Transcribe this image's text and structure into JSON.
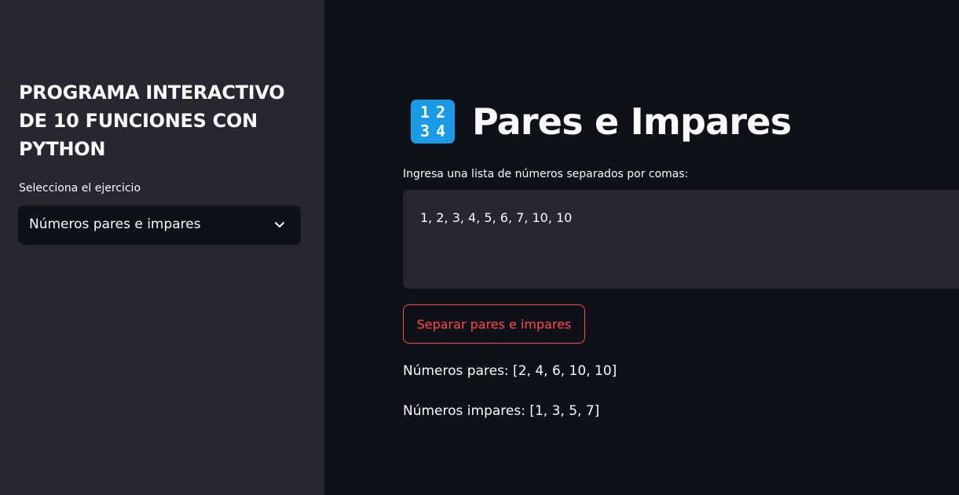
{
  "sidebar": {
    "title": "PROGRAMA INTERACTIVO DE 10 FUNCIONES CON PYTHON",
    "select_label": "Selecciona el ejercicio",
    "select_value": "Números pares e impares"
  },
  "main": {
    "icon_digits": [
      "1",
      "2",
      "3",
      "4"
    ],
    "title": "Pares e Impares",
    "input_label": "Ingresa una lista de números separados por comas:",
    "input_value": "1, 2, 3, 4, 5, 6, 7, 10, 10",
    "button_label": "Separar pares e impares",
    "even_result": "Números pares: [2, 4, 6, 10, 10]",
    "odd_result": "Números impares: [1, 3, 5, 7]"
  },
  "colors": {
    "app_background": "#0e1117",
    "sidebar_background": "#262730",
    "accent": "#ff4b4b",
    "icon_background": "#1b9be6",
    "text": "#fafafa"
  },
  "icons": {
    "title_icon": "keycap-1234-icon",
    "select_icon": "chevron-down-icon"
  }
}
